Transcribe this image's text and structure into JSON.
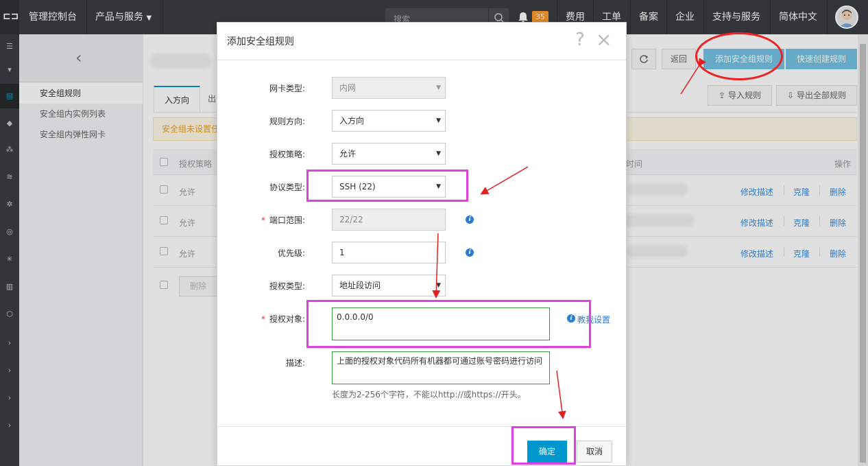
{
  "topbar": {
    "console": "管理控制台",
    "products": "产品与服务",
    "search_placeholder": "搜索",
    "notification_count": "35",
    "nav": [
      "费用",
      "工单",
      "备案",
      "企业",
      "支持与服务",
      "简体中文"
    ]
  },
  "sidebar": {
    "items": [
      "安全组规则",
      "安全组内实例列表",
      "安全组内弹性网卡"
    ]
  },
  "main": {
    "return_label": "返回",
    "add_rule_label": "添加安全组规则",
    "quick_create_label": "快速创建规则",
    "import_label": "导入规则",
    "export_label": "导出全部规则",
    "tab_in": "入方向",
    "tab_out": "出",
    "notice": "安全组未设置任",
    "col_policy": "授权策略",
    "col_time": "时间",
    "col_actions": "操作",
    "rows": [
      {
        "policy": "允许",
        "edit": "修改描述",
        "clone": "克隆",
        "delete": "删除"
      },
      {
        "policy": "允许",
        "edit": "修改描述",
        "clone": "克隆",
        "delete": "删除"
      },
      {
        "policy": "允许",
        "edit": "修改描述",
        "clone": "克隆",
        "delete": "删除"
      }
    ],
    "bulk_delete": "删除"
  },
  "modal": {
    "title": "添加安全组规则",
    "nic_type_label": "网卡类型:",
    "nic_type_value": "内网",
    "direction_label": "规则方向:",
    "direction_value": "入方向",
    "policy_label": "授权策略:",
    "policy_value": "允许",
    "protocol_label": "协议类型:",
    "protocol_value": "SSH (22)",
    "port_label": "端口范围:",
    "port_value": "22/22",
    "priority_label": "优先级:",
    "priority_value": "1",
    "auth_type_label": "授权类型:",
    "auth_type_value": "地址段访问",
    "auth_object_label": "授权对象:",
    "auth_object_value": "0.0.0.0/0",
    "teach_label": "教我设置",
    "desc_label": "描述:",
    "desc_value": "上面的授权对象代码所有机器都可通过账号密码进行访问",
    "hint": "长度为2-256个字符，不能以http://或https://开头。",
    "ok_label": "确定",
    "cancel_label": "取消"
  },
  "colors": {
    "primary_blue": "#0097cf",
    "highlight_magenta": "#e040e0",
    "annotation_red": "#e22222",
    "topbar_bg": "#3a3d41"
  }
}
